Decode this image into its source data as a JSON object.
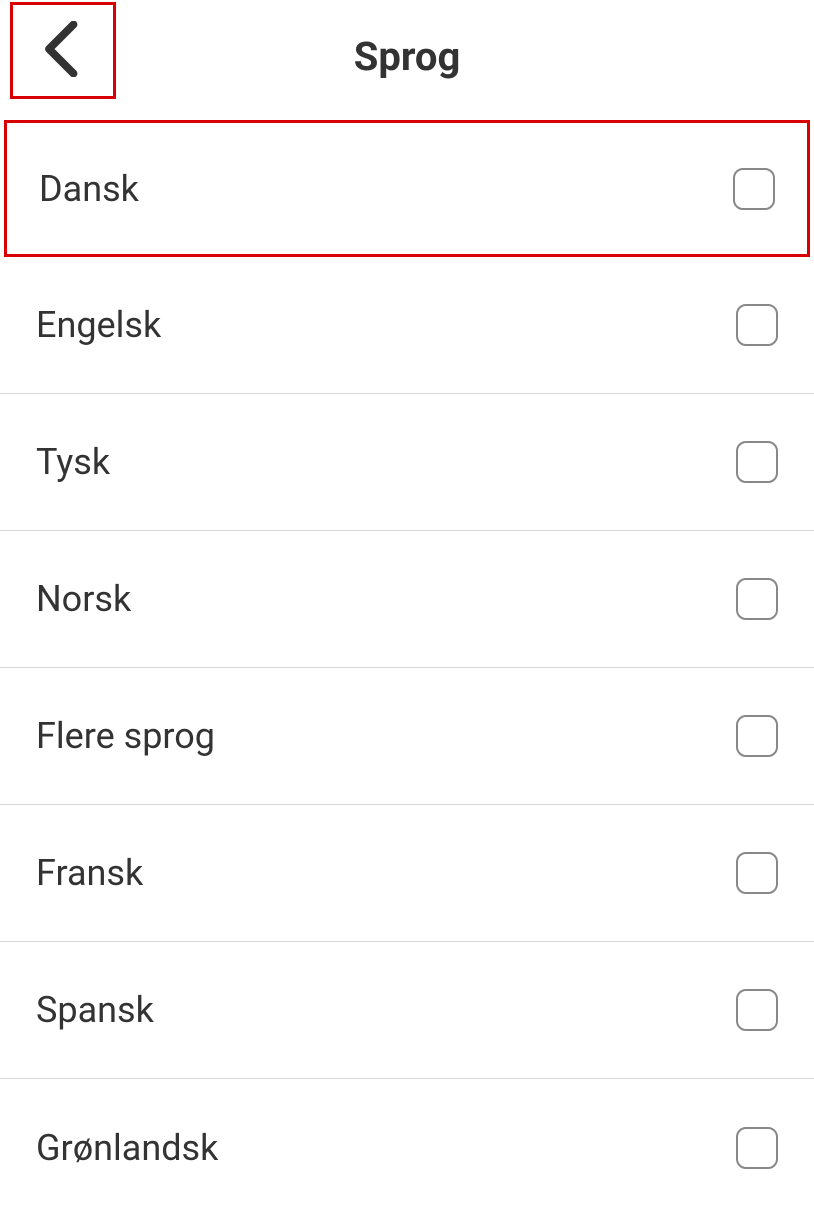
{
  "header": {
    "title": "Sprog"
  },
  "languages": [
    {
      "label": "Dansk",
      "checked": false,
      "highlighted": true
    },
    {
      "label": "Engelsk",
      "checked": false,
      "highlighted": false
    },
    {
      "label": "Tysk",
      "checked": false,
      "highlighted": false
    },
    {
      "label": "Norsk",
      "checked": false,
      "highlighted": false
    },
    {
      "label": "Flere sprog",
      "checked": false,
      "highlighted": false
    },
    {
      "label": "Fransk",
      "checked": false,
      "highlighted": false
    },
    {
      "label": "Spansk",
      "checked": false,
      "highlighted": false
    },
    {
      "label": "Grønlandsk",
      "checked": false,
      "highlighted": false
    }
  ]
}
